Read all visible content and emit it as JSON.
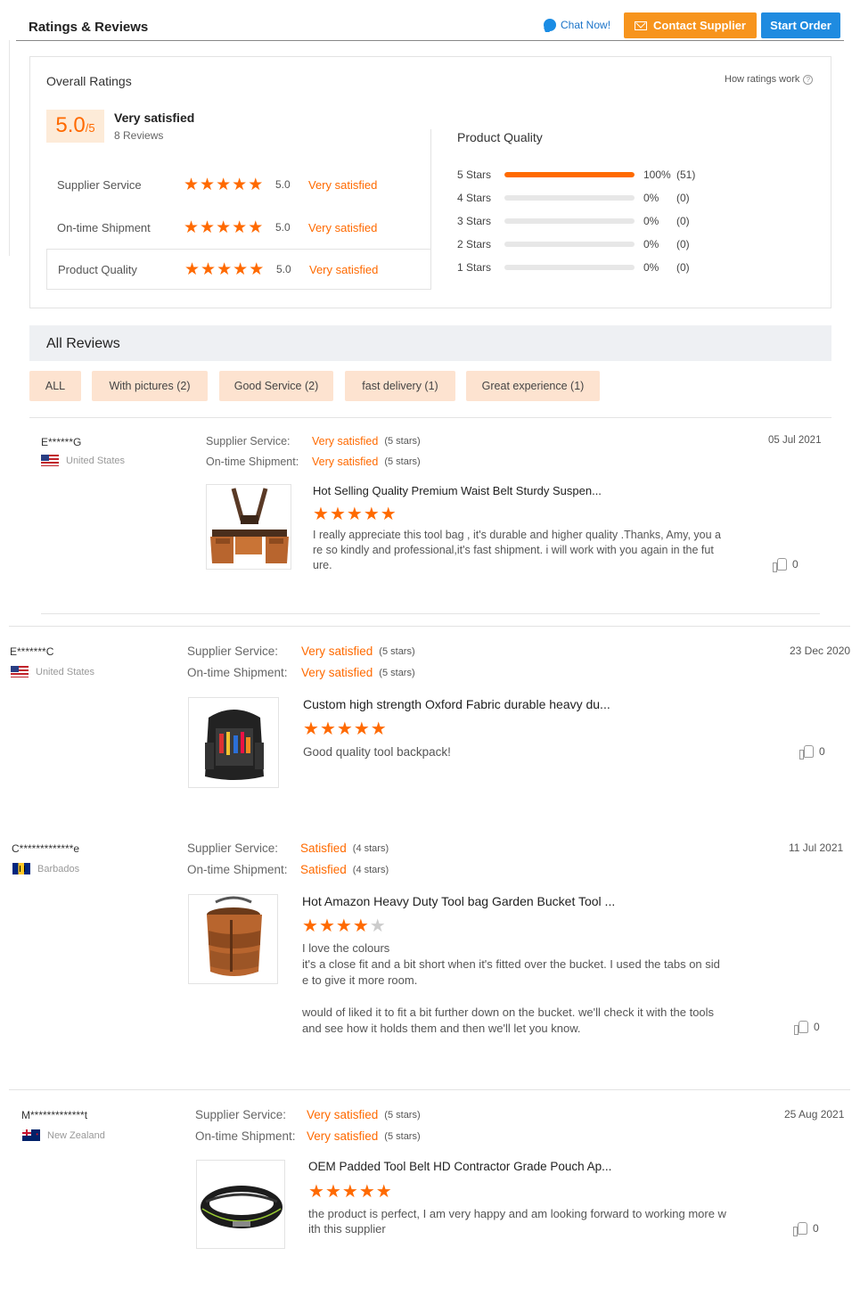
{
  "header": {
    "title": "Ratings & Reviews",
    "chat_label": "Chat Now!",
    "contact_label": "Contact Supplier",
    "start_label": "Start Order"
  },
  "overall": {
    "title": "Overall Ratings",
    "how_label": "How ratings work",
    "score": "5.0",
    "score_den": "/5",
    "score_text": "Very satisfied",
    "reviews": "8 Reviews",
    "categories": [
      {
        "name": "Supplier Service",
        "value": "5.0",
        "desc": "Very satisfied",
        "stars": 5
      },
      {
        "name": "On-time Shipment",
        "value": "5.0",
        "desc": "Very satisfied",
        "stars": 5
      },
      {
        "name": "Product Quality",
        "value": "5.0",
        "desc": "Very satisfied",
        "stars": 5
      }
    ]
  },
  "product_quality": {
    "title": "Product Quality",
    "rows": [
      {
        "label": "5  Stars",
        "pct": "100%",
        "count": "(51)",
        "fill": 1.0
      },
      {
        "label": "4  Stars",
        "pct": "0%",
        "count": "(0)",
        "fill": 0
      },
      {
        "label": "3  Stars",
        "pct": "0%",
        "count": "(0)",
        "fill": 0
      },
      {
        "label": "2  Stars",
        "pct": "0%",
        "count": "(0)",
        "fill": 0
      },
      {
        "label": "1  Stars",
        "pct": "0%",
        "count": "(0)",
        "fill": 0
      }
    ]
  },
  "all_reviews": {
    "title": "All Reviews",
    "filters": [
      "ALL",
      "With pictures (2)",
      "Good Service (2)",
      "fast delivery (1)",
      "Great experience (1)"
    ]
  },
  "labels": {
    "supplier_service": "Supplier Service:",
    "ontime_shipment": "On-time Shipment:"
  },
  "reviews": [
    {
      "name": "E******G",
      "country": "United States",
      "date": "05 Jul 2021",
      "service": "Very satisfied",
      "service_stars": "(5 stars)",
      "shipment": "Very satisfied",
      "shipment_stars": "(5 stars)",
      "product": "Hot Selling Quality Premium Waist Belt Sturdy Suspen...",
      "rating": 5,
      "text": [
        "I really appreciate this tool bag , it's durable and higher quality .Thanks, Amy, you a",
        "re so kindly and professional,it's fast shipment. i will work with you again in the fut",
        "ure."
      ],
      "likes": "0"
    },
    {
      "name": "E*******C",
      "country": "United States",
      "date": "23 Dec 2020",
      "service": "Very satisfied",
      "service_stars": "(5 stars)",
      "shipment": "Very satisfied",
      "shipment_stars": "(5 stars)",
      "product": "Custom high strength Oxford Fabric durable heavy du...",
      "rating": 5,
      "text": [
        "Good quality tool backpack!"
      ],
      "likes": "0"
    },
    {
      "name": "C*************e",
      "country": "Barbados",
      "date": "11 Jul 2021",
      "service": "Satisfied",
      "service_stars": "(4 stars)",
      "shipment": "Satisfied",
      "shipment_stars": "(4 stars)",
      "product": "Hot Amazon Heavy Duty Tool bag Garden Bucket Tool ...",
      "rating": 4,
      "text": [
        "I love the colours",
        "it's a close fit and a bit short when it's fitted over the bucket. I used the tabs on sid",
        "e to give it more room.",
        "",
        "would of liked it to fit a bit further down on the bucket. we'll check it with the tools",
        "and see how it holds them and then we'll let you know."
      ],
      "likes": "0"
    },
    {
      "name": "M*************t",
      "country": "New Zealand",
      "date": "25 Aug 2021",
      "service": "Very satisfied",
      "service_stars": "(5 stars)",
      "shipment": "Very satisfied",
      "shipment_stars": "(5 stars)",
      "product": "OEM Padded Tool Belt HD Contractor Grade Pouch Ap...",
      "rating": 5,
      "text": [
        "the product is perfect, I am very happy and am looking forward to working more w",
        "ith this supplier"
      ],
      "likes": "0"
    }
  ],
  "colors": {
    "accent": "#ff6a00",
    "contact": "#f7941d",
    "start": "#1f8be0"
  }
}
